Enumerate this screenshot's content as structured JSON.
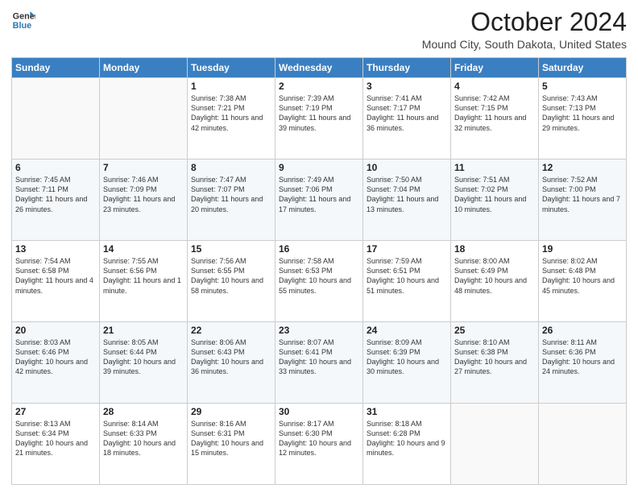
{
  "logo": {
    "line1": "General",
    "line2": "Blue"
  },
  "title": "October 2024",
  "location": "Mound City, South Dakota, United States",
  "weekdays": [
    "Sunday",
    "Monday",
    "Tuesday",
    "Wednesday",
    "Thursday",
    "Friday",
    "Saturday"
  ],
  "weeks": [
    [
      {
        "day": null
      },
      {
        "day": null
      },
      {
        "day": "1",
        "sunrise": "Sunrise: 7:38 AM",
        "sunset": "Sunset: 7:21 PM",
        "daylight": "Daylight: 11 hours and 42 minutes."
      },
      {
        "day": "2",
        "sunrise": "Sunrise: 7:39 AM",
        "sunset": "Sunset: 7:19 PM",
        "daylight": "Daylight: 11 hours and 39 minutes."
      },
      {
        "day": "3",
        "sunrise": "Sunrise: 7:41 AM",
        "sunset": "Sunset: 7:17 PM",
        "daylight": "Daylight: 11 hours and 36 minutes."
      },
      {
        "day": "4",
        "sunrise": "Sunrise: 7:42 AM",
        "sunset": "Sunset: 7:15 PM",
        "daylight": "Daylight: 11 hours and 32 minutes."
      },
      {
        "day": "5",
        "sunrise": "Sunrise: 7:43 AM",
        "sunset": "Sunset: 7:13 PM",
        "daylight": "Daylight: 11 hours and 29 minutes."
      }
    ],
    [
      {
        "day": "6",
        "sunrise": "Sunrise: 7:45 AM",
        "sunset": "Sunset: 7:11 PM",
        "daylight": "Daylight: 11 hours and 26 minutes."
      },
      {
        "day": "7",
        "sunrise": "Sunrise: 7:46 AM",
        "sunset": "Sunset: 7:09 PM",
        "daylight": "Daylight: 11 hours and 23 minutes."
      },
      {
        "day": "8",
        "sunrise": "Sunrise: 7:47 AM",
        "sunset": "Sunset: 7:07 PM",
        "daylight": "Daylight: 11 hours and 20 minutes."
      },
      {
        "day": "9",
        "sunrise": "Sunrise: 7:49 AM",
        "sunset": "Sunset: 7:06 PM",
        "daylight": "Daylight: 11 hours and 17 minutes."
      },
      {
        "day": "10",
        "sunrise": "Sunrise: 7:50 AM",
        "sunset": "Sunset: 7:04 PM",
        "daylight": "Daylight: 11 hours and 13 minutes."
      },
      {
        "day": "11",
        "sunrise": "Sunrise: 7:51 AM",
        "sunset": "Sunset: 7:02 PM",
        "daylight": "Daylight: 11 hours and 10 minutes."
      },
      {
        "day": "12",
        "sunrise": "Sunrise: 7:52 AM",
        "sunset": "Sunset: 7:00 PM",
        "daylight": "Daylight: 11 hours and 7 minutes."
      }
    ],
    [
      {
        "day": "13",
        "sunrise": "Sunrise: 7:54 AM",
        "sunset": "Sunset: 6:58 PM",
        "daylight": "Daylight: 11 hours and 4 minutes."
      },
      {
        "day": "14",
        "sunrise": "Sunrise: 7:55 AM",
        "sunset": "Sunset: 6:56 PM",
        "daylight": "Daylight: 11 hours and 1 minute."
      },
      {
        "day": "15",
        "sunrise": "Sunrise: 7:56 AM",
        "sunset": "Sunset: 6:55 PM",
        "daylight": "Daylight: 10 hours and 58 minutes."
      },
      {
        "day": "16",
        "sunrise": "Sunrise: 7:58 AM",
        "sunset": "Sunset: 6:53 PM",
        "daylight": "Daylight: 10 hours and 55 minutes."
      },
      {
        "day": "17",
        "sunrise": "Sunrise: 7:59 AM",
        "sunset": "Sunset: 6:51 PM",
        "daylight": "Daylight: 10 hours and 51 minutes."
      },
      {
        "day": "18",
        "sunrise": "Sunrise: 8:00 AM",
        "sunset": "Sunset: 6:49 PM",
        "daylight": "Daylight: 10 hours and 48 minutes."
      },
      {
        "day": "19",
        "sunrise": "Sunrise: 8:02 AM",
        "sunset": "Sunset: 6:48 PM",
        "daylight": "Daylight: 10 hours and 45 minutes."
      }
    ],
    [
      {
        "day": "20",
        "sunrise": "Sunrise: 8:03 AM",
        "sunset": "Sunset: 6:46 PM",
        "daylight": "Daylight: 10 hours and 42 minutes."
      },
      {
        "day": "21",
        "sunrise": "Sunrise: 8:05 AM",
        "sunset": "Sunset: 6:44 PM",
        "daylight": "Daylight: 10 hours and 39 minutes."
      },
      {
        "day": "22",
        "sunrise": "Sunrise: 8:06 AM",
        "sunset": "Sunset: 6:43 PM",
        "daylight": "Daylight: 10 hours and 36 minutes."
      },
      {
        "day": "23",
        "sunrise": "Sunrise: 8:07 AM",
        "sunset": "Sunset: 6:41 PM",
        "daylight": "Daylight: 10 hours and 33 minutes."
      },
      {
        "day": "24",
        "sunrise": "Sunrise: 8:09 AM",
        "sunset": "Sunset: 6:39 PM",
        "daylight": "Daylight: 10 hours and 30 minutes."
      },
      {
        "day": "25",
        "sunrise": "Sunrise: 8:10 AM",
        "sunset": "Sunset: 6:38 PM",
        "daylight": "Daylight: 10 hours and 27 minutes."
      },
      {
        "day": "26",
        "sunrise": "Sunrise: 8:11 AM",
        "sunset": "Sunset: 6:36 PM",
        "daylight": "Daylight: 10 hours and 24 minutes."
      }
    ],
    [
      {
        "day": "27",
        "sunrise": "Sunrise: 8:13 AM",
        "sunset": "Sunset: 6:34 PM",
        "daylight": "Daylight: 10 hours and 21 minutes."
      },
      {
        "day": "28",
        "sunrise": "Sunrise: 8:14 AM",
        "sunset": "Sunset: 6:33 PM",
        "daylight": "Daylight: 10 hours and 18 minutes."
      },
      {
        "day": "29",
        "sunrise": "Sunrise: 8:16 AM",
        "sunset": "Sunset: 6:31 PM",
        "daylight": "Daylight: 10 hours and 15 minutes."
      },
      {
        "day": "30",
        "sunrise": "Sunrise: 8:17 AM",
        "sunset": "Sunset: 6:30 PM",
        "daylight": "Daylight: 10 hours and 12 minutes."
      },
      {
        "day": "31",
        "sunrise": "Sunrise: 8:18 AM",
        "sunset": "Sunset: 6:28 PM",
        "daylight": "Daylight: 10 hours and 9 minutes."
      },
      {
        "day": null
      },
      {
        "day": null
      }
    ]
  ]
}
